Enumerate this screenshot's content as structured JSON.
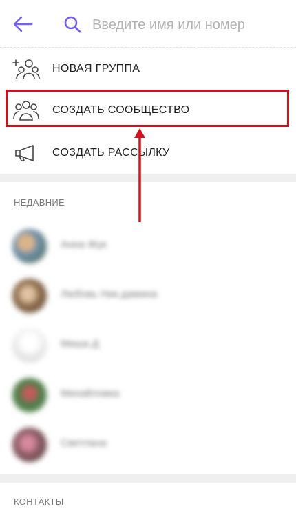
{
  "header": {
    "back_icon": "arrow-left-icon",
    "search_icon": "search-icon",
    "search_placeholder": "Введите имя или номер",
    "accent_color": "#7360f2"
  },
  "actions": [
    {
      "label": "НОВАЯ ГРУППА",
      "icon": "add-group-icon"
    },
    {
      "label": "СОЗДАТЬ СООБЩЕСТВО",
      "icon": "community-icon",
      "highlighted": true
    },
    {
      "label": "СОЗДАТЬ РАССЫЛКУ",
      "icon": "megaphone-icon"
    }
  ],
  "annotation": {
    "highlight_color": "#d0121d",
    "arrow_color": "#d0121d"
  },
  "recent": {
    "title": "НЕДАВНИЕ",
    "contacts": [
      {
        "name": "Анна Жук",
        "color": "#6f8fae"
      },
      {
        "name": "Любовь Ник.дамина",
        "color": "#8c6b4a"
      },
      {
        "name": "Миша Д",
        "color": "#e4e4e4"
      },
      {
        "name": "Михайловка",
        "color": "#4e7f4a"
      },
      {
        "name": "Светлана",
        "color": "#8a5a63"
      }
    ]
  },
  "contacts_section": {
    "title": "КОНТАКТЫ"
  }
}
